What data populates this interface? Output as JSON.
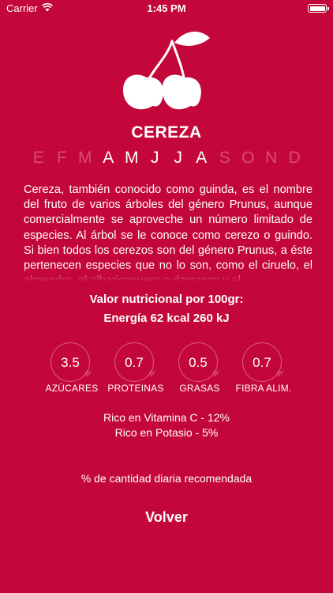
{
  "status_bar": {
    "carrier": "Carrier",
    "time": "1:45 PM"
  },
  "fruit": {
    "name": "CEREZA",
    "icon": "cherry-icon",
    "months": [
      {
        "letter": "E",
        "in_season": false
      },
      {
        "letter": "F",
        "in_season": false
      },
      {
        "letter": "M",
        "in_season": false
      },
      {
        "letter": "A",
        "in_season": true
      },
      {
        "letter": "M",
        "in_season": true
      },
      {
        "letter": "J",
        "in_season": true
      },
      {
        "letter": "J",
        "in_season": true
      },
      {
        "letter": "A",
        "in_season": true
      },
      {
        "letter": "S",
        "in_season": false
      },
      {
        "letter": "O",
        "in_season": false
      },
      {
        "letter": "N",
        "in_season": false
      },
      {
        "letter": "D",
        "in_season": false
      }
    ],
    "description": "Cereza, también conocido como guinda, es el nombre del fruto de varios árboles del género Prunus, aunque comercialmente se aproveche un número limitado de especies. Al árbol se le conoce como cerezo o guindo. Si bien todos los cerezos son del género Prunus, a éste pertenecen especies que no lo son, como el ciruelo, el almendro, el albaricoquero o damasco y el"
  },
  "nutrition": {
    "title": "Valor nutricional por 100gr:",
    "energy": "Energía 62 kcal 260 kJ",
    "items": [
      {
        "value": "3.5",
        "unit": "gr",
        "label": "AZÚCARES"
      },
      {
        "value": "0.7",
        "unit": "gr",
        "label": "PROTEINAS"
      },
      {
        "value": "0.5",
        "unit": "gr",
        "label": "GRASAS"
      },
      {
        "value": "0.7",
        "unit": "gr",
        "label": "FIBRA ALIM."
      }
    ],
    "vitamins": [
      "Rico en Vitamina C - 12%",
      "Rico en Potasio - 5%"
    ],
    "daily_note": "% de cantidad diaria recomendada"
  },
  "actions": {
    "back_label": "Volver"
  },
  "colors": {
    "background": "#C4073A",
    "foreground": "#FFFFFF"
  }
}
